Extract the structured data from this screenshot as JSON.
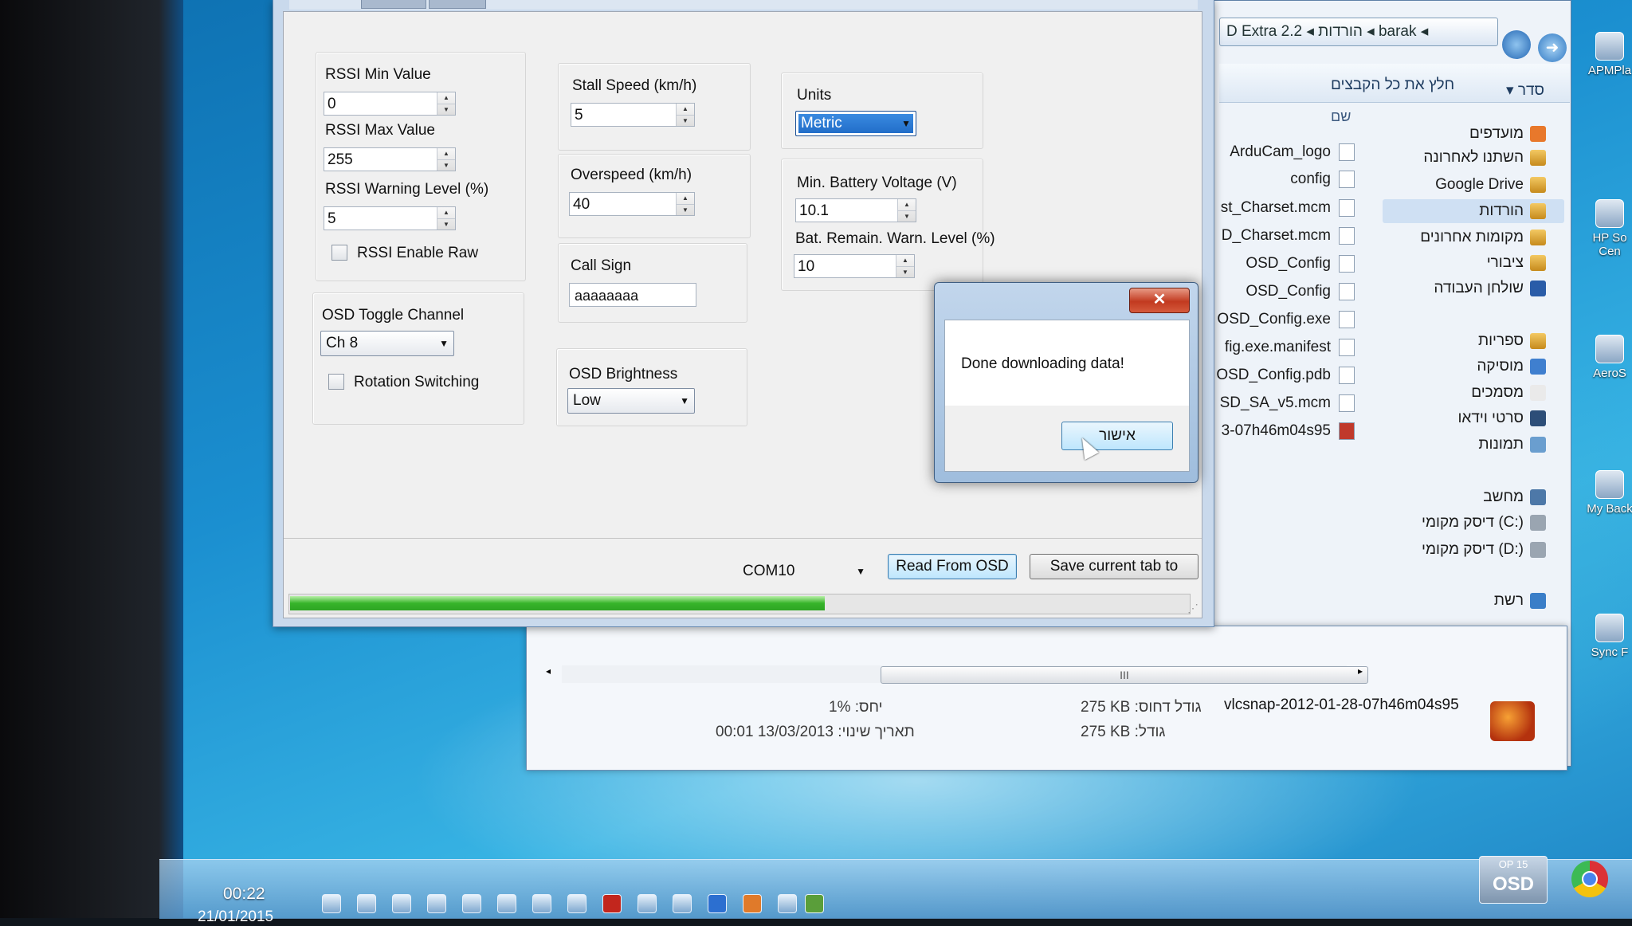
{
  "explorer": {
    "address": "D Extra 2.2 ◂ הורדות ◂ barak ◂",
    "toolbar_extract": "חלץ את כל הקבצים",
    "toolbar_organize": "▾ סדר",
    "name_column": "שם",
    "files": [
      "ArduCam_logo",
      "config",
      "st_Charset.mcm",
      "D_Charset.mcm",
      "OSD_Config",
      "OSD_Config",
      "OSD_Config.exe",
      "fig.exe.manifest",
      "OSD_Config.pdb",
      "SD_SA_v5.mcm",
      "3-07h46m04s95"
    ],
    "nav": [
      "מועדפים",
      "השתנו לאחרונה",
      "Google Drive",
      "הורדות",
      "מקומות אחרונים",
      "ציבורי",
      "שולחן העבודה",
      "ספריות",
      "מוסיקה",
      "מסמכים",
      "סרטי וידאו",
      "תמונות",
      "מחשב",
      "דיסק מקומי (C:)",
      "דיסק מקומי (D:)",
      "רשת"
    ],
    "scroll_grip": "III",
    "details": {
      "ratio": "1%  :יחס",
      "modified": "00:01 13/03/2013  :תאריך שינוי",
      "compressed_size": "275 KB  :גודל דחוס",
      "size": "275 KB  :גודל",
      "filename": "vlcsnap-2012-01-28-07h46m04s95"
    }
  },
  "desktop_icons": [
    "APMPla",
    "HP So Cen",
    "AeroS",
    "My Back",
    "Sync F"
  ],
  "osd": {
    "rssi_min_label": "RSSI Min Value",
    "rssi_min_value": "0",
    "rssi_max_label": "RSSI Max Value",
    "rssi_max_value": "255",
    "rssi_warn_label": "RSSI Warning Level (%)",
    "rssi_warn_value": "5",
    "rssi_raw_label": "RSSI Enable Raw",
    "toggle_label": "OSD Toggle Channel",
    "toggle_value": "Ch 8",
    "rotation_label": "Rotation Switching",
    "stall_label": "Stall Speed (km/h)",
    "stall_value": "5",
    "overspeed_label": "Overspeed (km/h)",
    "overspeed_value": "40",
    "callsign_label": "Call Sign",
    "callsign_value": "aaaaaaaa",
    "brightness_label": "OSD Brightness",
    "brightness_value": "Low",
    "units_label": "Units",
    "units_value": "Metric",
    "battery_label": "Min. Battery Voltage (V)",
    "battery_value": "10.1",
    "bat_remain_label": "Bat. Remain. Warn. Level (%)",
    "bat_remain_value": "10",
    "com_port": "COM10",
    "read_button": "Read From OSD",
    "save_button": "Save current tab to",
    "progress": 0.595
  },
  "dialog": {
    "close": "✕",
    "message": "Done downloading data!",
    "ok": "אישור"
  },
  "taskbar": {
    "time": "00:22",
    "date": "21/01/2015",
    "osd_t1": "OP 15",
    "osd_t2": "OSD"
  },
  "colors": {
    "progress_green": "#37b42a",
    "close_red": "#c23a20",
    "selected_blue": "#1f6ac6"
  }
}
